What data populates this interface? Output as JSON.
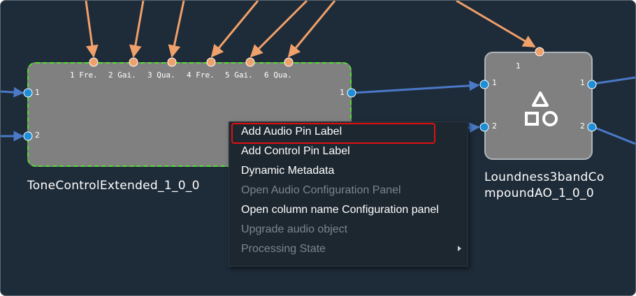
{
  "colors": {
    "canvas_bg": "#1e2b38",
    "block_fill": "#808080",
    "selected_outline": "#4ce12a",
    "audio_wire": "#4a79c8",
    "control_wire": "#f0a06a",
    "audio_pin": "#1e8fd6",
    "control_pin": "#f0a06a",
    "menu_bg": "#1d2730",
    "highlight_box": "#e01010",
    "disabled_text": "#7c858d"
  },
  "blocks": {
    "tone": {
      "name": "ToneControlExtended_1_0_0",
      "control_pins": [
        "1  Fre.",
        "2  Gai.",
        "3  Qua.",
        "4  Fre.",
        "5  Gai.",
        "6  Qua."
      ],
      "inputs": [
        "1",
        "2"
      ],
      "outputs": [
        "1"
      ]
    },
    "loudness": {
      "name_line1": "Loundness3bandCo",
      "name_line2": "mpoundAO_1_0_0",
      "control_pins": [
        "1"
      ],
      "inputs": [
        "1",
        "2"
      ],
      "outputs": [
        "1",
        "2"
      ],
      "icon": "shapes-icon"
    }
  },
  "context_menu": {
    "items": [
      {
        "label": "Add Audio Pin Label",
        "enabled": true,
        "highlighted": true
      },
      {
        "label": "Add Control Pin Label",
        "enabled": true
      },
      {
        "label": "Dynamic Metadata",
        "enabled": true
      },
      {
        "label": "Open Audio Configuration Panel",
        "enabled": false
      },
      {
        "label": "Open column name Configuration panel",
        "enabled": true
      },
      {
        "label": "Upgrade audio object",
        "enabled": false
      },
      {
        "label": "Processing State",
        "enabled": false,
        "submenu": true
      }
    ]
  }
}
